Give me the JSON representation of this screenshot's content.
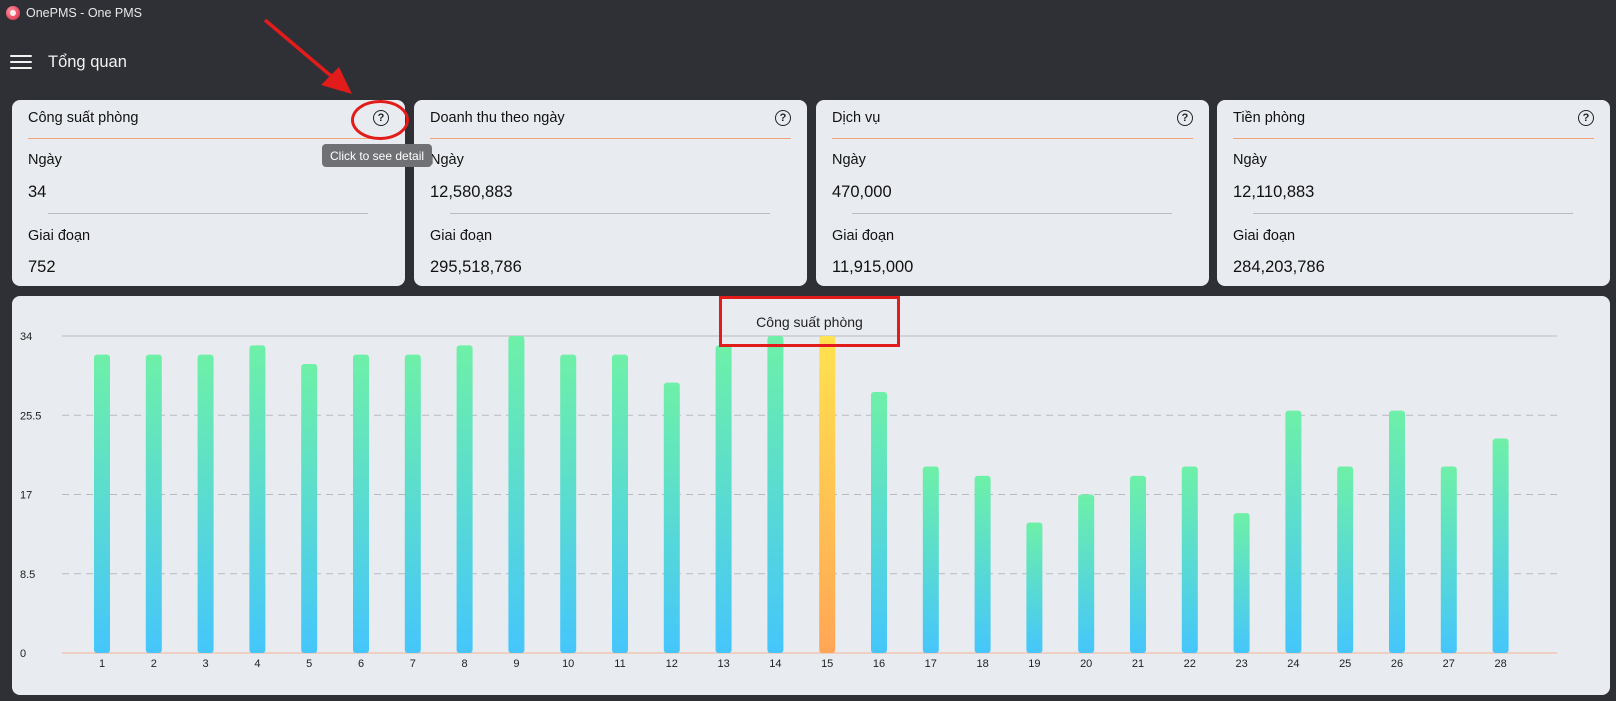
{
  "window": {
    "title": "OnePMS - One PMS"
  },
  "header": {
    "page_title": "Tổng quan"
  },
  "cards": [
    {
      "title": "Công suất phòng",
      "day_label": "Ngày",
      "day_value": "34",
      "period_label": "Giai đoạn",
      "period_value": "752"
    },
    {
      "title": "Doanh thu theo ngày",
      "day_label": "Ngày",
      "day_value": "12,580,883",
      "period_label": "Giai đoạn",
      "period_value": "295,518,786"
    },
    {
      "title": "Dịch vụ",
      "day_label": "Ngày",
      "day_value": "470,000",
      "period_label": "Giai đoạn",
      "period_value": "11,915,000"
    },
    {
      "title": "Tiền phòng",
      "day_label": "Ngày",
      "day_value": "12,110,883",
      "period_label": "Giai đoạn",
      "period_value": "284,203,786"
    }
  ],
  "tooltip": {
    "text": "Click to see detail"
  },
  "icons": {
    "help": "question-circle-icon",
    "menu": "hamburger-menu-icon"
  },
  "colors": {
    "accent_rule": "#f3a37a",
    "bar_top": "#6ef0a8",
    "bar_bottom": "#45c6fb",
    "highlight_top": "#ffe24f",
    "highlight_bottom": "#ffa656",
    "annotation": "#e21b1b"
  },
  "chart_data": {
    "type": "bar",
    "title": "Công suất phòng",
    "categories": [
      "1",
      "2",
      "3",
      "4",
      "5",
      "6",
      "7",
      "8",
      "9",
      "10",
      "11",
      "12",
      "13",
      "14",
      "15",
      "16",
      "17",
      "18",
      "19",
      "20",
      "21",
      "22",
      "23",
      "24",
      "25",
      "26",
      "27",
      "28"
    ],
    "values": [
      32,
      32,
      32,
      33,
      31,
      32,
      32,
      33,
      34,
      32,
      32,
      29,
      33,
      34,
      34,
      28,
      20,
      19,
      14,
      17,
      19,
      20,
      15,
      26,
      20,
      26,
      20,
      23
    ],
    "highlight_category": "15",
    "ylim": [
      0,
      34
    ],
    "yticks": [
      "0",
      "8.5",
      "17",
      "25.5",
      "34"
    ],
    "grid": true
  }
}
